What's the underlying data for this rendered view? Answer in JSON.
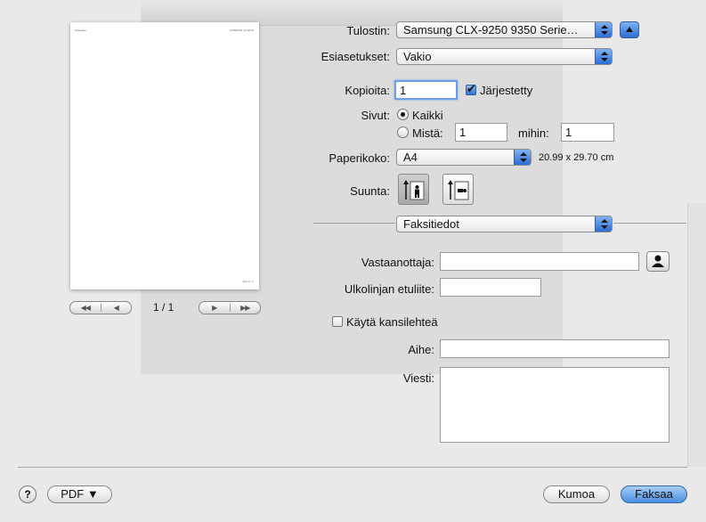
{
  "preview": {
    "header_left": "Hakuehto",
    "header_right": "12/09/2011 12:18:15",
    "footer": "Sivu 1 / 1",
    "page_indicator": "1 / 1"
  },
  "form": {
    "printer_label": "Tulostin:",
    "printer_value": "Samsung CLX-9250 9350 Serie…",
    "presets_label": "Esiasetukset:",
    "presets_value": "Vakio",
    "copies_label": "Kopioita:",
    "copies_value": "1",
    "collated_label": "Järjestetty",
    "collated_checked": true,
    "pages_label": "Sivut:",
    "pages_all_label": "Kaikki",
    "pages_from_label": "Mistä:",
    "pages_from_value": "1",
    "pages_to_label": "mihin:",
    "pages_to_value": "1",
    "paper_label": "Paperikoko:",
    "paper_value": "A4",
    "paper_dims": "20.99 x 29.70 cm",
    "orientation_label": "Suunta:",
    "section_value": "Faksitiedot",
    "recipient_label": "Vastaanottaja:",
    "recipient_value": "",
    "prefix_label": "Ulkolinjan etuliite:",
    "prefix_value": "",
    "cover_label": "Käytä kansilehteä",
    "cover_checked": false,
    "subject_label": "Aihe:",
    "subject_value": "",
    "message_label": "Viesti:",
    "message_value": ""
  },
  "footer": {
    "help_label": "?",
    "pdf_label": "PDF ▼",
    "cancel_label": "Kumoa",
    "fax_label": "Faksaa"
  },
  "colors": {
    "accent": "#4b8fe0",
    "focus_ring": "#6c9de8"
  }
}
